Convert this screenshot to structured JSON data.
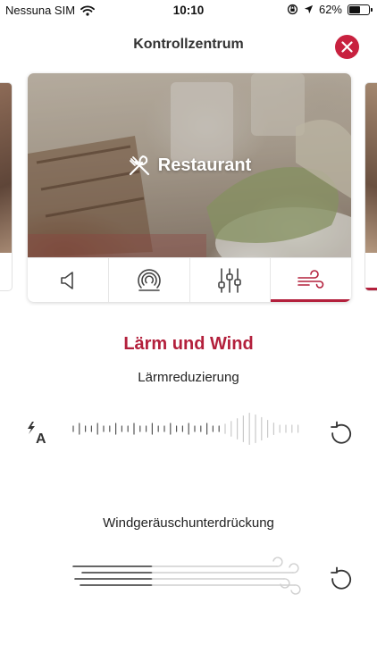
{
  "status_bar": {
    "carrier": "Nessuna SIM",
    "time": "10:10",
    "battery": "62%",
    "battery_level": 0.62,
    "icons": [
      "wifi-icon",
      "orientation-lock-icon",
      "location-icon",
      "battery-icon"
    ]
  },
  "header": {
    "title": "Kontrollzentrum",
    "close_icon": "close-icon"
  },
  "card": {
    "program": "Restaurant",
    "program_icon": "fork-knife-icon",
    "tabs": [
      {
        "icon": "speaker-volume-icon",
        "active": false
      },
      {
        "icon": "hearing-loop-icon",
        "active": false
      },
      {
        "icon": "equalizer-sliders-icon",
        "active": false
      },
      {
        "icon": "wind-icon",
        "active": true
      }
    ]
  },
  "section": {
    "title": "Lärm und Wind",
    "noise_label": "Lärmreduzierung",
    "wind_label": "Windgeräuschunterdrückung"
  },
  "controls": {
    "noise_auto_icon": "auto-adjust-icon",
    "noise_level": 0.78,
    "wind_level": 0.34,
    "reset_icon": "reset-icon"
  },
  "colors": {
    "accent": "#b3203c",
    "close_button": "#c8213f"
  }
}
